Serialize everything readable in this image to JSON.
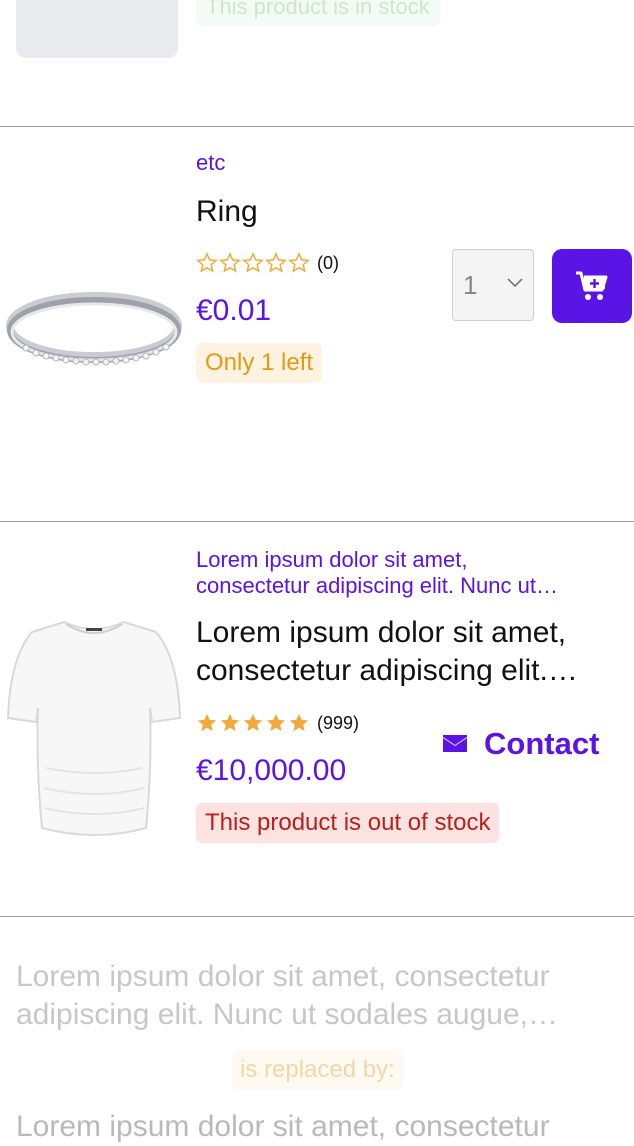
{
  "top_item": {
    "stock_text": "This product is in stock"
  },
  "ring": {
    "category": "etc",
    "title": "Ring",
    "rating": 0,
    "rating_count": "(0)",
    "price": "€0.01",
    "stock_badge": "Only 1 left",
    "quantity": "1"
  },
  "shirt": {
    "category_line1": "Lorem ipsum dolor sit amet,",
    "category_line2": "consectetur adipiscing elit. Nunc ut…",
    "title_line1": "Lorem ipsum dolor sit amet,",
    "title_line2": "consectetur adipiscing elit.…",
    "rating": 5,
    "rating_count": "(999)",
    "price": "€10,000.00",
    "stock_badge": "This product is out of stock",
    "contact_label": "Contact"
  },
  "bottom_item": {
    "text_line1": "Lorem ipsum dolor sit amet, consectetur",
    "text_line2": "adipiscing elit. Nunc ut sodales augue,…",
    "replaced_label": "is replaced by:",
    "text_line3": "Lorem ipsum dolor sit amet, consectetur"
  },
  "colors": {
    "accent": "#5b14e6",
    "star": "#f0a93a",
    "warn": "#e29a16",
    "error": "#b5221c"
  }
}
